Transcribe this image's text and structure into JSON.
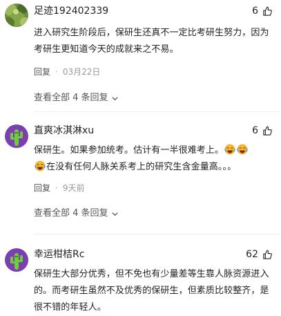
{
  "comments": [
    {
      "username": "足迹192402339",
      "likes": "6",
      "text": "进入研究生阶段后，保研生还真不一定比考研生努力，因为考研生更知道今天的成就来之不易。",
      "reply_label": "回复",
      "dot": "·",
      "time": "03月22日",
      "view_all": "查看全部 4 条回复"
    },
    {
      "username": "直爽冰淇淋xu",
      "likes": "6",
      "text_part1": "保研生。如果参加统考。估计有一半很难考上。",
      "text_part2": "在没有任何人脉关系考上的研究生含金量高。。。",
      "reply_label": "回复",
      "dot": "·",
      "time": "9天前",
      "view_all": "查看全部 4 条回复"
    },
    {
      "username": "幸运柑桔Rc",
      "likes": "62",
      "text": "保研生大部分优秀，但不免也有少量差等生靠人脉资源进入的。而考研生虽然不及优秀的保研生，但素质比较整齐，是很不错的年轻人。"
    }
  ],
  "icons": {
    "like": "thumbs-up-icon",
    "expand": "chevron-down-icon",
    "emoji": "crying-laughing-emoji-icon"
  }
}
